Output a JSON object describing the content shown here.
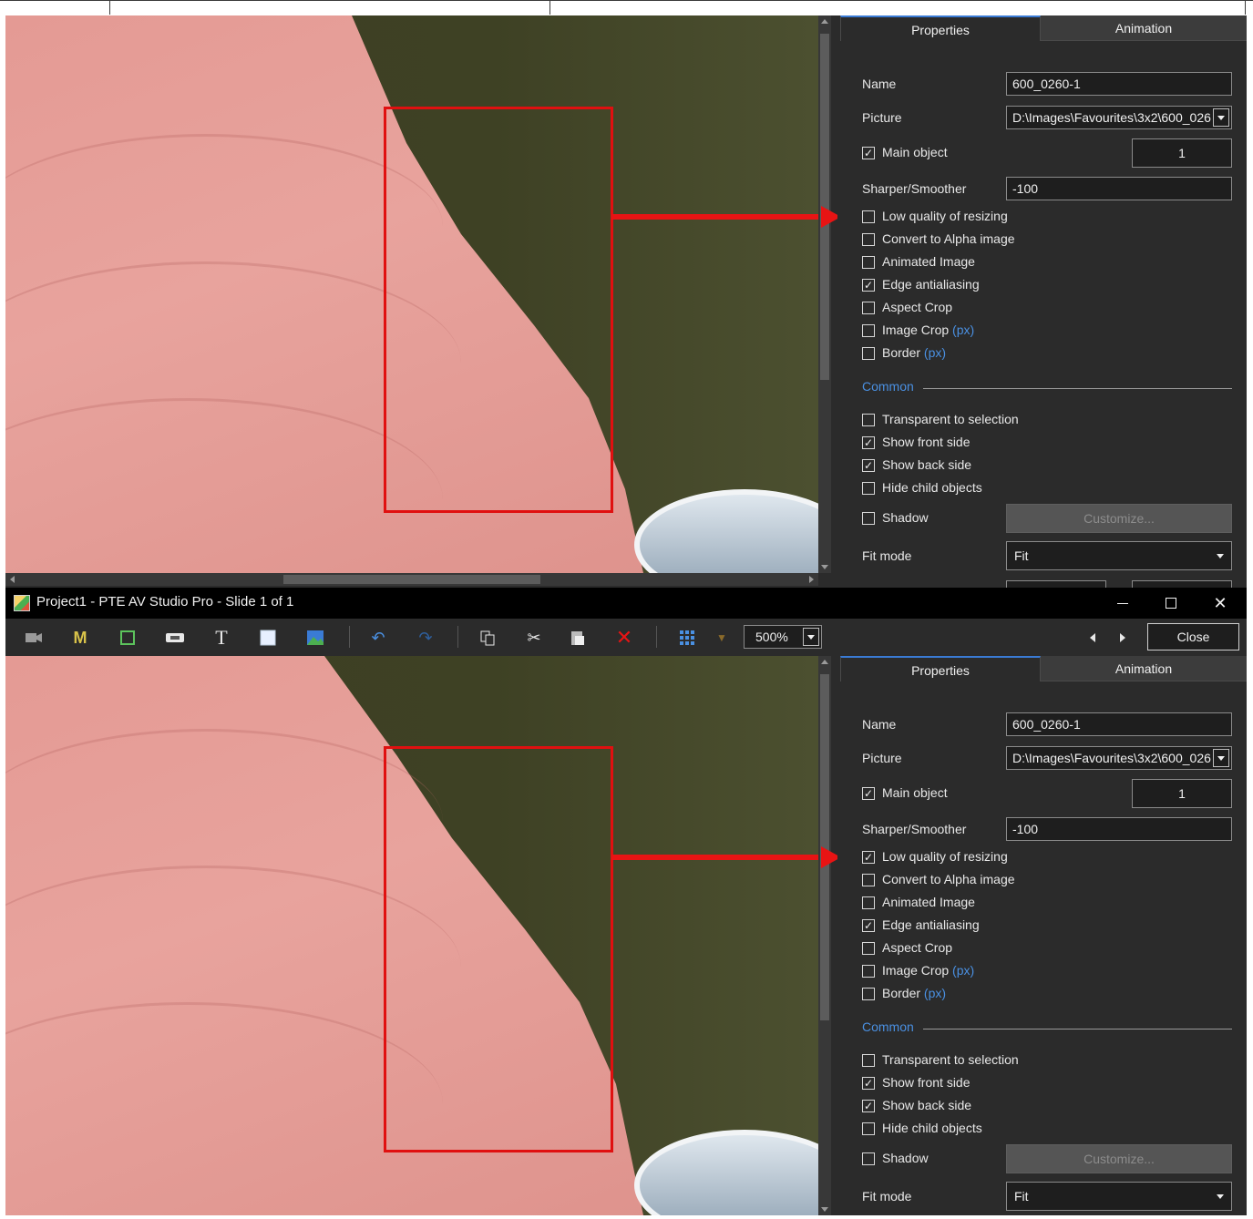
{
  "window": {
    "title": "Project1 - PTE AV Studio Pro - Slide 1 of 1",
    "minimize_glyph": "—",
    "maximize_glyph": "☐",
    "close_glyph": "✕"
  },
  "toolbar": {
    "zoom_value": "500%",
    "close_label": "Close",
    "icons": [
      "camera-icon",
      "mask-icon",
      "frame-icon",
      "button-icon",
      "text-icon",
      "rectangle-icon",
      "picture-icon",
      "undo-icon",
      "redo-icon",
      "copy-icon",
      "cut-icon",
      "paste-icon",
      "delete-icon",
      "grid-icon",
      "grid-dropdown-icon",
      "previous-icon",
      "next-icon"
    ]
  },
  "panel": {
    "tabs": {
      "properties": "Properties",
      "animation": "Animation"
    },
    "name_label": "Name",
    "name_value": "600_0260-1",
    "picture_label": "Picture",
    "picture_value": "D:\\Images\\Favourites\\3x2\\600_026",
    "main_object_label": "Main object",
    "main_object_number": "1",
    "sharper_label": "Sharper/Smoother",
    "sharper_value": "-100",
    "common_label": "Common",
    "shadow_label": "Shadow",
    "customize_label": "Customize...",
    "fit_mode_label": "Fit mode",
    "fit_mode_value": "Fit",
    "px_label": "(px)"
  },
  "checkboxes_top": {
    "main_object": true,
    "low_quality": false,
    "convert_alpha": false,
    "animated": false,
    "edge_aa": true,
    "aspect_crop": false,
    "image_crop": false,
    "border": false,
    "transparent": false,
    "front": true,
    "back": true,
    "hide_child": false,
    "shadow": false
  },
  "checkboxes_bottom": {
    "main_object": true,
    "low_quality": true,
    "convert_alpha": false,
    "animated": false,
    "edge_aa": true,
    "aspect_crop": false,
    "image_crop": false,
    "border": false,
    "transparent": false,
    "front": true,
    "back": true,
    "hide_child": false,
    "shadow": false
  },
  "checkbox_labels": {
    "low_quality": "Low quality of resizing",
    "convert_alpha": "Convert to Alpha image",
    "animated": "Animated Image",
    "edge_aa": "Edge antialiasing",
    "aspect_crop": "Aspect Crop",
    "image_crop": "Image Crop",
    "border": "Border",
    "transparent": "Transparent to selection",
    "front": "Show front side",
    "back": "Show back side",
    "hide_child": "Hide child objects"
  },
  "colors": {
    "highlight": "#e01010",
    "accent": "#3a7bd5",
    "link": "#4a90e2",
    "background": "#2b2b2b"
  }
}
